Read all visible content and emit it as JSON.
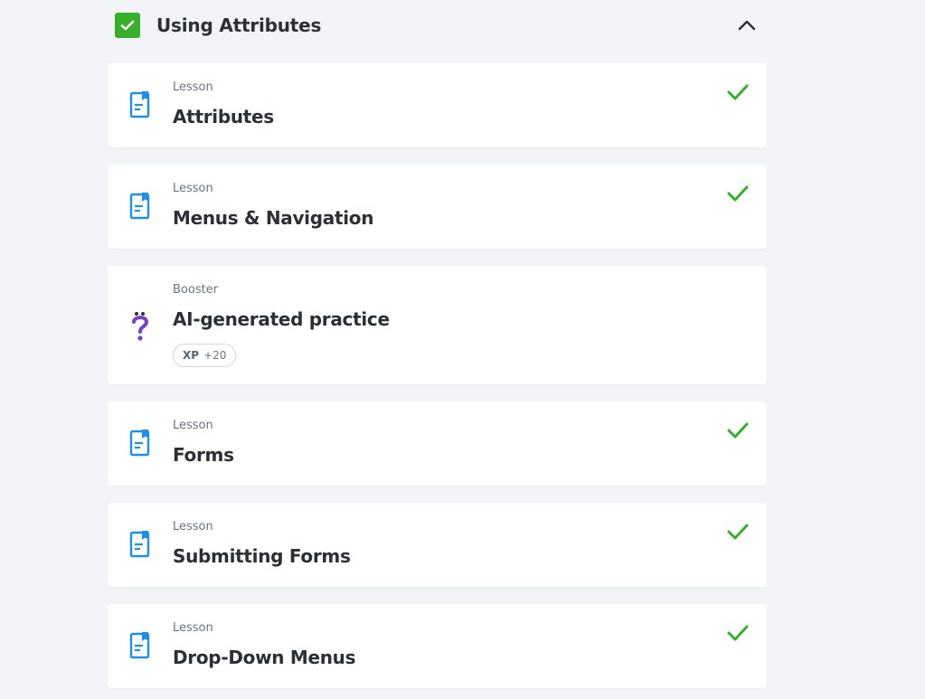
{
  "section": {
    "title": "Using Attributes",
    "completed": true
  },
  "items": [
    {
      "type": "Lesson",
      "title": "Attributes",
      "done": true
    },
    {
      "type": "Lesson",
      "title": "Menus & Navigation",
      "done": true
    },
    {
      "type": "Booster",
      "title": "AI-generated practice",
      "done": false,
      "xp_label": "XP",
      "xp_value": "+20"
    },
    {
      "type": "Lesson",
      "title": "Forms",
      "done": true
    },
    {
      "type": "Lesson",
      "title": "Submitting Forms",
      "done": true
    },
    {
      "type": "Lesson",
      "title": "Drop-Down Menus",
      "done": true
    }
  ],
  "colors": {
    "accent_green": "#36b02a",
    "lesson_icon_blue": "#1e90e8",
    "booster_icon_purple": "#7b3fc4"
  },
  "icons": {
    "section_check": "checkbox-checked-icon",
    "collapse": "chevron-up-icon",
    "lesson": "lesson-document-icon",
    "booster": "question-mark-icon",
    "done": "checkmark-icon"
  }
}
